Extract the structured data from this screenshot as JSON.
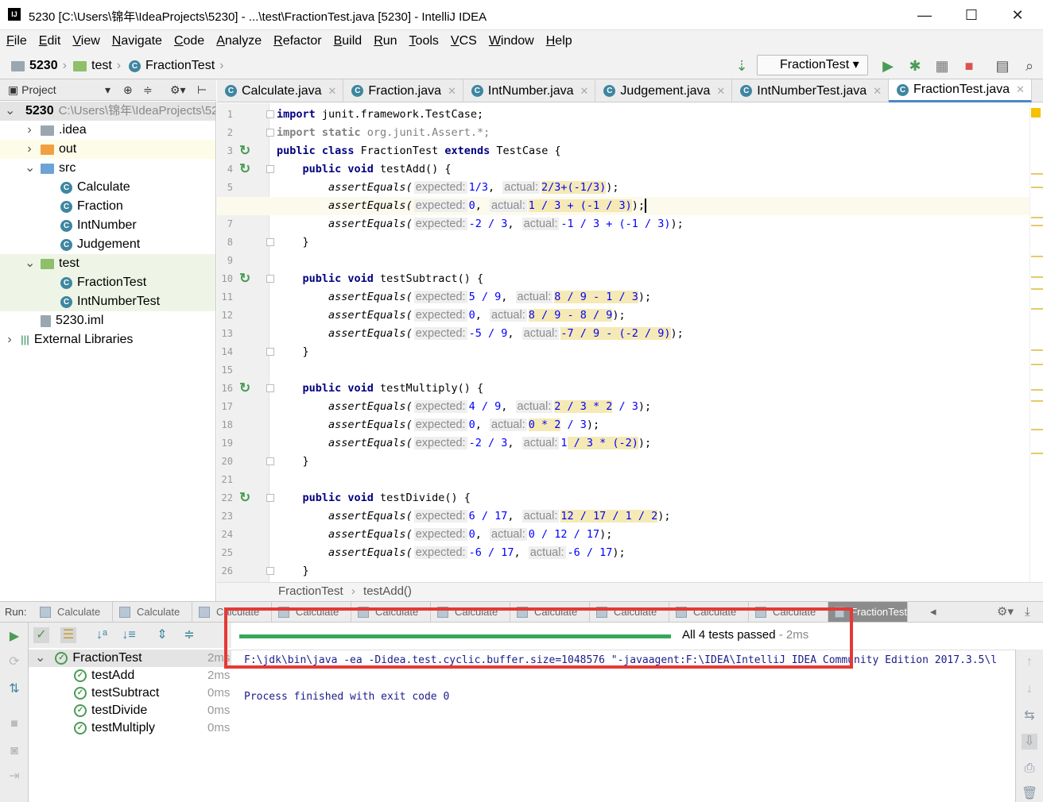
{
  "window": {
    "title": "5230 [C:\\Users\\锦年\\IdeaProjects\\5230] - ...\\test\\FractionTest.java [5230] - IntelliJ IDEA",
    "logo": "IJ",
    "minimize": "—",
    "maximize": "☐",
    "close": "✕"
  },
  "menu": [
    "File",
    "Edit",
    "View",
    "Navigate",
    "Code",
    "Analyze",
    "Refactor",
    "Build",
    "Run",
    "Tools",
    "VCS",
    "Window",
    "Help"
  ],
  "breadcrumb": {
    "project": "5230",
    "folder": "test",
    "file": "FractionTest"
  },
  "toolbar": {
    "run_config": "FractionTest"
  },
  "project_panel": {
    "title": "Project",
    "items": [
      {
        "label": "5230",
        "extra": "C:\\Users\\锦年\\IdeaProjects\\5230",
        "kind": "module",
        "level": 0,
        "open": true
      },
      {
        "label": ".idea",
        "kind": "folder",
        "level": 1,
        "open": false
      },
      {
        "label": "out",
        "kind": "folder-orange",
        "level": 1,
        "open": false
      },
      {
        "label": "src",
        "kind": "folder-blue",
        "level": 1,
        "open": true
      },
      {
        "label": "Calculate",
        "kind": "class",
        "level": 2
      },
      {
        "label": "Fraction",
        "kind": "class",
        "level": 2
      },
      {
        "label": "IntNumber",
        "kind": "class",
        "level": 2
      },
      {
        "label": "Judgement",
        "kind": "class",
        "level": 2
      },
      {
        "label": "test",
        "kind": "folder-green",
        "level": 1,
        "open": true
      },
      {
        "label": "FractionTest",
        "kind": "class",
        "level": 2
      },
      {
        "label": "IntNumberTest",
        "kind": "class",
        "level": 2
      },
      {
        "label": "5230.iml",
        "kind": "file",
        "level": 1
      },
      {
        "label": "External Libraries",
        "kind": "lib",
        "level": 0,
        "open": false
      }
    ]
  },
  "editor_tabs": [
    {
      "label": "Calculate.java"
    },
    {
      "label": "Fraction.java"
    },
    {
      "label": "IntNumber.java"
    },
    {
      "label": "Judgement.java"
    },
    {
      "label": "IntNumberTest.java"
    },
    {
      "label": "FractionTest.java",
      "active": true
    }
  ],
  "code": {
    "current_line": 6,
    "run_markers": [
      3,
      4,
      10,
      16,
      22
    ],
    "lines": [
      [
        [
          "k",
          "import"
        ],
        [
          "p",
          " junit.framework.TestCase;"
        ]
      ],
      [
        [
          "gk",
          "import static"
        ],
        [
          "g",
          " org.junit.Assert.*;"
        ]
      ],
      [
        [
          "k",
          "public class"
        ],
        [
          "p",
          " FractionTest "
        ],
        [
          "k",
          "extends"
        ],
        [
          "p",
          " TestCase {"
        ]
      ],
      [
        [
          "p",
          "    "
        ],
        [
          "k",
          "public void"
        ],
        [
          "p",
          " testAdd() {"
        ]
      ],
      [
        [
          "p",
          "        "
        ],
        [
          "i",
          "assertEquals("
        ],
        [
          "h",
          "expected:"
        ],
        [
          "x",
          "1/3"
        ],
        [
          "p",
          ", "
        ],
        [
          "h",
          "actual:"
        ],
        [
          "xh",
          "2/3+(-1/3)"
        ],
        [
          "p",
          ");"
        ]
      ],
      [
        [
          "p",
          "        "
        ],
        [
          "i",
          "assertEquals("
        ],
        [
          "h",
          "expected:"
        ],
        [
          "x",
          "0"
        ],
        [
          "p",
          ", "
        ],
        [
          "h",
          "actual:"
        ],
        [
          "xh",
          "1 / 3 + (-1 / 3)"
        ],
        [
          "p",
          ");"
        ],
        [
          "c",
          ""
        ]
      ],
      [
        [
          "p",
          "        "
        ],
        [
          "i",
          "assertEquals("
        ],
        [
          "h",
          "expected:"
        ],
        [
          "x",
          "-2 / 3"
        ],
        [
          "p",
          ", "
        ],
        [
          "h",
          "actual:"
        ],
        [
          "x",
          "-1 / 3 + (-1 / 3)"
        ],
        [
          "p",
          ");"
        ]
      ],
      [
        [
          "p",
          "    }"
        ]
      ],
      [
        [
          "p",
          ""
        ]
      ],
      [
        [
          "p",
          "    "
        ],
        [
          "k",
          "public void"
        ],
        [
          "p",
          " testSubtract() {"
        ]
      ],
      [
        [
          "p",
          "        "
        ],
        [
          "i",
          "assertEquals("
        ],
        [
          "h",
          "expected:"
        ],
        [
          "x",
          "5 / 9"
        ],
        [
          "p",
          ", "
        ],
        [
          "h",
          "actual:"
        ],
        [
          "xh",
          "8 / 9 - 1 / 3"
        ],
        [
          "p",
          ");"
        ]
      ],
      [
        [
          "p",
          "        "
        ],
        [
          "i",
          "assertEquals("
        ],
        [
          "h",
          "expected:"
        ],
        [
          "x",
          "0"
        ],
        [
          "p",
          ", "
        ],
        [
          "h",
          "actual:"
        ],
        [
          "xh",
          "8 / 9 - 8 / 9"
        ],
        [
          "p",
          ");"
        ]
      ],
      [
        [
          "p",
          "        "
        ],
        [
          "i",
          "assertEquals("
        ],
        [
          "h",
          "expected:"
        ],
        [
          "x",
          "-5 / 9"
        ],
        [
          "p",
          ", "
        ],
        [
          "h",
          "actual:"
        ],
        [
          "xh",
          "-7 / 9 - (-2 / 9)"
        ],
        [
          "p",
          ");"
        ]
      ],
      [
        [
          "p",
          "    }"
        ]
      ],
      [
        [
          "p",
          ""
        ]
      ],
      [
        [
          "p",
          "    "
        ],
        [
          "k",
          "public void"
        ],
        [
          "p",
          " testMultiply() {"
        ]
      ],
      [
        [
          "p",
          "        "
        ],
        [
          "i",
          "assertEquals("
        ],
        [
          "h",
          "expected:"
        ],
        [
          "x",
          "4 / 9"
        ],
        [
          "p",
          ", "
        ],
        [
          "h",
          "actual:"
        ],
        [
          "xh",
          "2 / 3 * 2"
        ],
        [
          "x",
          " / 3"
        ],
        [
          "p",
          ");"
        ]
      ],
      [
        [
          "p",
          "        "
        ],
        [
          "i",
          "assertEquals("
        ],
        [
          "h",
          "expected:"
        ],
        [
          "x",
          "0"
        ],
        [
          "p",
          ", "
        ],
        [
          "h",
          "actual:"
        ],
        [
          "xh",
          "0 * 2"
        ],
        [
          "x",
          " / 3"
        ],
        [
          "p",
          ");"
        ]
      ],
      [
        [
          "p",
          "        "
        ],
        [
          "i",
          "assertEquals("
        ],
        [
          "h",
          "expected:"
        ],
        [
          "x",
          "-2 / 3"
        ],
        [
          "p",
          ", "
        ],
        [
          "h",
          "actual:"
        ],
        [
          "x",
          "1"
        ],
        [
          "xh",
          " / 3 * (-2)"
        ],
        [
          "p",
          ");"
        ]
      ],
      [
        [
          "p",
          "    }"
        ]
      ],
      [
        [
          "p",
          ""
        ]
      ],
      [
        [
          "p",
          "    "
        ],
        [
          "k",
          "public void"
        ],
        [
          "p",
          " testDivide() {"
        ]
      ],
      [
        [
          "p",
          "        "
        ],
        [
          "i",
          "assertEquals("
        ],
        [
          "h",
          "expected:"
        ],
        [
          "x",
          "6 / 17"
        ],
        [
          "p",
          ", "
        ],
        [
          "h",
          "actual:"
        ],
        [
          "xh",
          "12 / 17 / 1 / 2"
        ],
        [
          "p",
          ");"
        ]
      ],
      [
        [
          "p",
          "        "
        ],
        [
          "i",
          "assertEquals("
        ],
        [
          "h",
          "expected:"
        ],
        [
          "x",
          "0"
        ],
        [
          "p",
          ", "
        ],
        [
          "h",
          "actual:"
        ],
        [
          "x",
          "0 / 12 / 17"
        ],
        [
          "p",
          ");"
        ]
      ],
      [
        [
          "p",
          "        "
        ],
        [
          "i",
          "assertEquals("
        ],
        [
          "h",
          "expected:"
        ],
        [
          "x",
          "-6 / 17"
        ],
        [
          "p",
          ", "
        ],
        [
          "h",
          "actual:"
        ],
        [
          "x",
          "-6 / 17"
        ],
        [
          "p",
          ");"
        ]
      ],
      [
        [
          "p",
          "    }"
        ]
      ]
    ]
  },
  "editor_breadcrumb": {
    "class": "FractionTest",
    "method": "testAdd()"
  },
  "run": {
    "label": "Run:",
    "tabs": [
      "Calculate",
      "Calculate",
      "Calculate",
      "Calculate",
      "Calculate",
      "Calculate",
      "Calculate",
      "Calculate",
      "Calculate",
      "Calculate",
      "FractionTest"
    ],
    "status": "All 4 tests passed",
    "status_time": "- 2ms",
    "progress": 1.0,
    "tests": [
      {
        "name": "FractionTest",
        "time": "2ms",
        "root": true
      },
      {
        "name": "testAdd",
        "time": "2ms"
      },
      {
        "name": "testSubtract",
        "time": "0ms"
      },
      {
        "name": "testDivide",
        "time": "0ms"
      },
      {
        "name": "testMultiply",
        "time": "0ms"
      }
    ],
    "console": [
      "F:\\jdk\\bin\\java -ea -Didea.test.cyclic.buffer.size=1048576 \"-javaagent:F:\\IDEA\\IntelliJ IDEA Community Edition 2017.3.5\\l",
      "",
      "Process finished with exit code 0"
    ]
  },
  "colors": {
    "keyword": "#000080",
    "number": "#0000ff",
    "pass": "#37a85a",
    "highlight_box": "#e53935",
    "current_line": "#fcfaed"
  }
}
